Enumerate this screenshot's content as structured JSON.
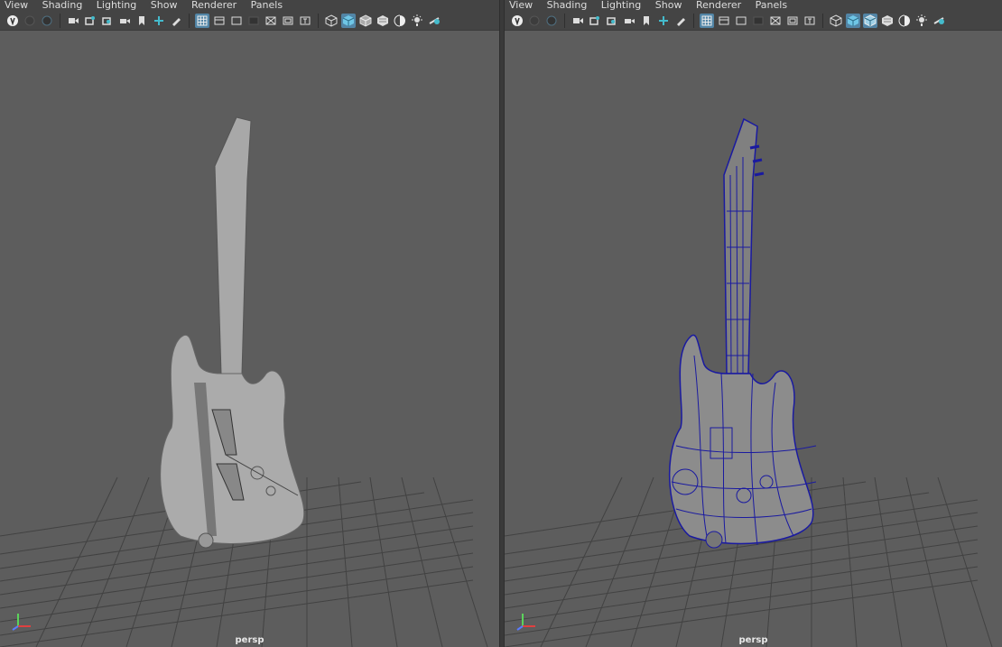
{
  "menu": [
    "View",
    "Shading",
    "Lighting",
    "Show",
    "Renderer",
    "Panels"
  ],
  "toolbar_icons_left": [
    "select-camera-icon",
    "camera-attributes-icon",
    "bookmark-icon",
    "camera-tools-icon",
    "image-plane-icon",
    "two-d-pan-icon",
    "grease-pencil-icon",
    "grid-icon",
    "film-gate-icon",
    "resolution-gate-icon",
    "gate-mask-icon",
    "field-chart-icon",
    "safe-action-icon",
    "wireframe-icon",
    "smooth-shade-icon",
    "wireframe-on-shaded-icon",
    "xray-icon",
    "use-lights-icon",
    "shadows-icon",
    "ambient-occlusion-icon",
    "motion-blur-icon"
  ],
  "viewports": {
    "left": {
      "camera": "persp",
      "shading": "smooth-shaded"
    },
    "right": {
      "camera": "persp",
      "shading": "wireframe-on-shaded"
    }
  },
  "axis": {
    "x": "x",
    "y": "y",
    "z": "z"
  },
  "colors": {
    "viewport_bg": "#5d5d5d",
    "toolbar_bg": "#444444",
    "grid": "#3f3f3f",
    "model_shaded": "#a8a8a8",
    "wireframe": "#1a1aa0",
    "active_button": "#5285a6"
  }
}
